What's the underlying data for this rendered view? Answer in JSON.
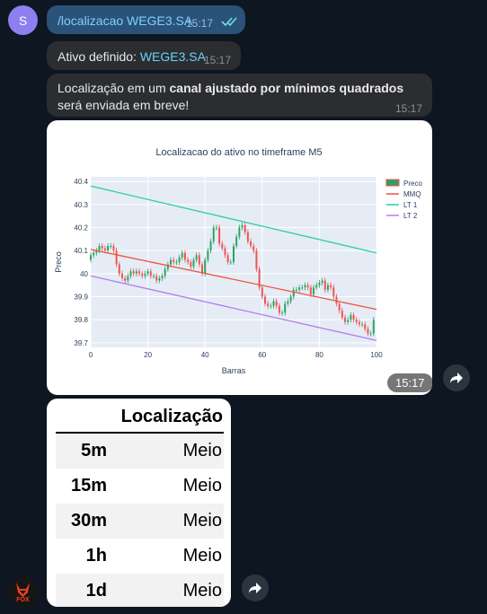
{
  "user_avatar": {
    "letter": "S"
  },
  "messages": {
    "command": {
      "text": "/localizacao WEGE3.SA",
      "time": "15:17"
    },
    "asset": {
      "prefix": "Ativo definido: ",
      "ticker": "WEGE3.SA",
      "time": "15:17"
    },
    "info": {
      "pre": "Localização em um ",
      "bold": "canal ajustado por mínimos quadrados",
      "post": " será enviada em breve!",
      "time": "15:17"
    },
    "chart_time": "15:17"
  },
  "chart_data": {
    "type": "line",
    "title": "Localizacao do ativo no timeframe M5",
    "xlabel": "Barras",
    "ylabel": "Preco",
    "xlim": [
      0,
      100
    ],
    "ylim": [
      39.68,
      40.42
    ],
    "xticks": [
      0,
      20,
      40,
      60,
      80,
      100
    ],
    "yticks": [
      39.7,
      39.8,
      39.9,
      40,
      40.1,
      40.2,
      40.3,
      40.4
    ],
    "grid": true,
    "legend_position": "top-right",
    "series": [
      {
        "name": "Preco",
        "kind": "candlestick",
        "color_up": "#2ca25f",
        "color_down": "#ef5350",
        "close": [
          40.08,
          40.09,
          40.1,
          40.12,
          40.11,
          40.1,
          40.12,
          40.12,
          40.1,
          40.04,
          40.0,
          39.98,
          39.97,
          39.99,
          40.01,
          40.0,
          40.01,
          40.0,
          39.99,
          40.0,
          40.01,
          39.99,
          39.99,
          39.97,
          39.98,
          39.99,
          40.02,
          40.04,
          40.06,
          40.05,
          40.05,
          40.07,
          40.09,
          40.06,
          40.05,
          40.03,
          40.06,
          40.08,
          40.04,
          40.0,
          40.06,
          40.1,
          40.14,
          40.2,
          40.2,
          40.13,
          40.11,
          40.08,
          40.05,
          40.05,
          40.12,
          40.16,
          40.2,
          40.21,
          40.18,
          40.14,
          40.12,
          40.1,
          40.02,
          39.94,
          39.9,
          39.87,
          39.86,
          39.86,
          39.88,
          39.86,
          39.83,
          39.83,
          39.87,
          39.88,
          39.9,
          39.93,
          39.93,
          39.94,
          39.94,
          39.95,
          39.94,
          39.91,
          39.94,
          39.95,
          39.96,
          39.97,
          39.93,
          39.95,
          39.94,
          39.9,
          39.87,
          39.84,
          39.81,
          39.79,
          39.8,
          39.82,
          39.8,
          39.79,
          39.78,
          39.78,
          39.76,
          39.74,
          39.74,
          39.8
        ]
      },
      {
        "name": "MMQ",
        "kind": "line",
        "color": "#ef553b",
        "x": [
          0,
          100
        ],
        "y": [
          40.105,
          39.845
        ]
      },
      {
        "name": "LT 1",
        "kind": "line",
        "color": "#2ccf9f",
        "x": [
          0,
          100
        ],
        "y": [
          40.38,
          40.09
        ]
      },
      {
        "name": "LT 2",
        "kind": "line",
        "color": "#b07ef0",
        "x": [
          0,
          100
        ],
        "y": [
          39.99,
          39.71
        ]
      }
    ]
  },
  "table": {
    "header": "Localização",
    "rows": [
      {
        "tf": "5m",
        "value": "Meio"
      },
      {
        "tf": "15m",
        "value": "Meio"
      },
      {
        "tf": "30m",
        "value": "Meio"
      },
      {
        "tf": "1h",
        "value": "Meio"
      },
      {
        "tf": "1d",
        "value": "Meio"
      }
    ]
  },
  "bot_avatar": {
    "label": "FOX"
  }
}
